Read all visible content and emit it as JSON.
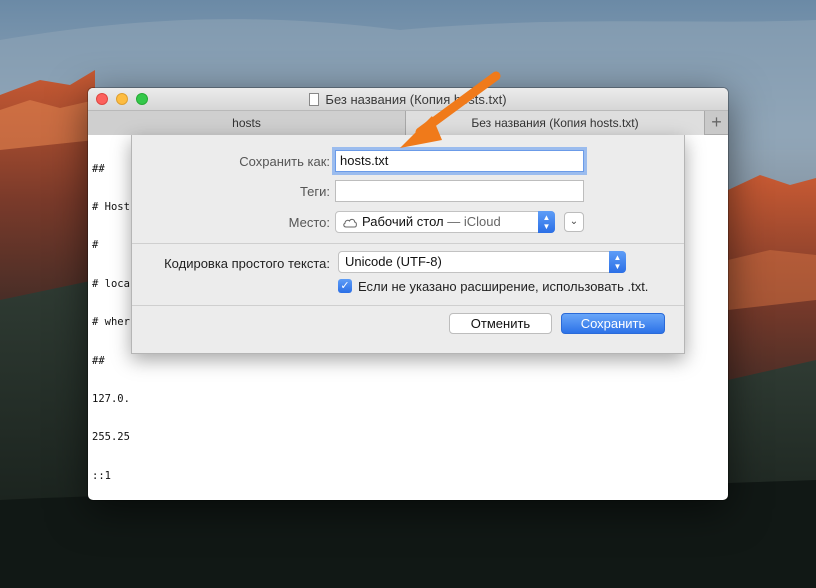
{
  "window": {
    "title": "Без названия (Копия hosts.txt)",
    "tabs": [
      {
        "label": "hosts"
      },
      {
        "label": "Без названия (Копия hosts.txt)"
      }
    ],
    "add_tab_label": "+",
    "editor_lines": [
      "##",
      "# Host",
      "#",
      "# loca",
      "# wher",
      "##",
      "127.0.",
      "255.25",
      "::1"
    ]
  },
  "save_dialog": {
    "save_as_label": "Сохранить как:",
    "save_as_value": "hosts.txt",
    "tags_label": "Теги:",
    "tags_value": "",
    "location_label": "Место:",
    "location_main": "Рабочий стол",
    "location_suffix": "— iCloud",
    "expand_label": "⌄",
    "encoding_label": "Кодировка простого текста:",
    "encoding_value": "Unicode (UTF-8)",
    "extension_checkbox_label": "Если не указано расширение, использовать .txt.",
    "extension_checked": true,
    "cancel_label": "Отменить",
    "save_label": "Сохранить"
  },
  "colors": {
    "accent": "#2c72e8",
    "annotation_arrow": "#f07a1a"
  },
  "icons": {
    "document": "doc-icon",
    "location": "cloud-icon",
    "check": "checkmark-icon",
    "popup_stepper": "up-down-chevron-icon"
  }
}
